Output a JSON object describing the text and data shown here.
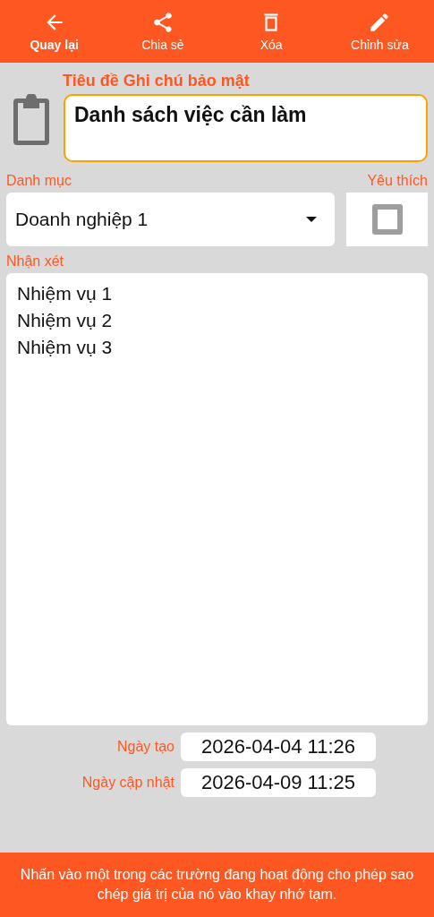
{
  "toolbar": [
    {
      "kind": "back",
      "label": "Quay lại",
      "selected": true
    },
    {
      "kind": "share",
      "label": "Chia sẻ",
      "selected": false
    },
    {
      "kind": "delete",
      "label": "Xóa",
      "selected": false
    },
    {
      "kind": "edit",
      "label": "Chỉnh sửa",
      "selected": false
    }
  ],
  "title_field": {
    "label": "Tiêu đề Ghi chú bảo mật",
    "value": "Danh sách việc cần làm"
  },
  "category": {
    "label": "Danh mục",
    "value": "Doanh nghiệp 1"
  },
  "favorite": {
    "label": "Yêu thích",
    "checked": false
  },
  "notes": {
    "label": "Nhận xét",
    "lines": [
      "Nhiệm vụ 1",
      "Nhiệm vụ 2",
      "Nhiệm vụ 3"
    ]
  },
  "dates": [
    {
      "label": "Ngày tạo",
      "value": "2026-04-04 11:26"
    },
    {
      "label": "Ngày cập nhật",
      "value": "2026-04-09 11:25"
    }
  ],
  "footer": "Nhấn vào một trong các trường đang hoạt động cho phép sao chép giá trị của nó vào khay nhớ tạm."
}
